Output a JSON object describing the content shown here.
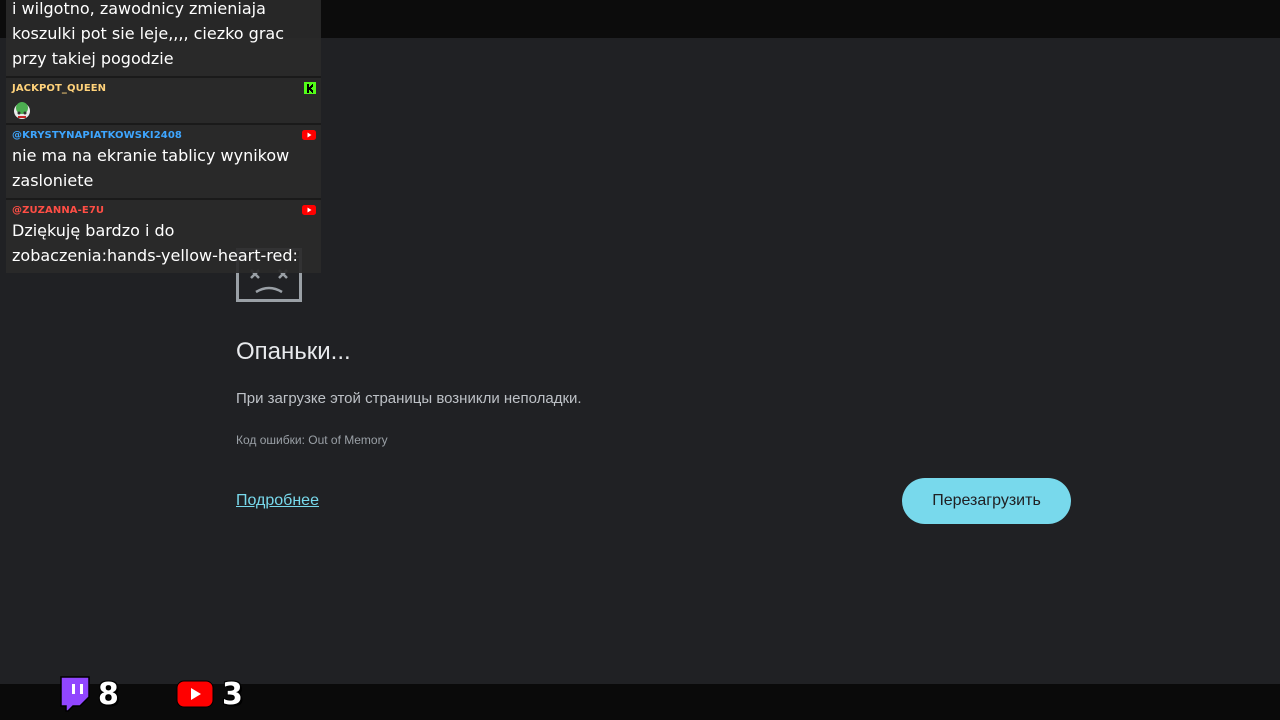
{
  "error_page": {
    "title": "Опаньки...",
    "description": "При загрузке этой страницы возникли неполадки.",
    "error_code": "Код ошибки: Out of Memory",
    "details_link": "Подробнее",
    "reload_button": "Перезагрузить",
    "icon": "sad-tab-icon",
    "accent_color": "#78d9ec"
  },
  "chat": {
    "messages": [
      {
        "user": "",
        "platform": "",
        "text": "i wilgotno, zawodnicy zmieniaja koszulki pot sie leje,,,, ciezko grac przy takiej pogodzie"
      },
      {
        "user": "JACKPOT_QUEEN",
        "platform": "kick",
        "user_color": "#ffd27a",
        "text": ""
      },
      {
        "user": "@KRYSTYNAPIATKOWSKI2408",
        "platform": "youtube",
        "user_color": "#3ea6ff",
        "text": "nie ma na ekranie tablicy wynikow zasloniete"
      },
      {
        "user": "@ZUZANNA-E7U",
        "platform": "youtube",
        "user_color": "#ff4e45",
        "text": "Dziękuję bardzo i do zobaczenia:hands-yellow-heart-red:"
      }
    ]
  },
  "viewers": {
    "twitch_count": "8",
    "youtube_count": "3",
    "twitch_color": "#9146ff",
    "youtube_color": "#ff0000"
  }
}
